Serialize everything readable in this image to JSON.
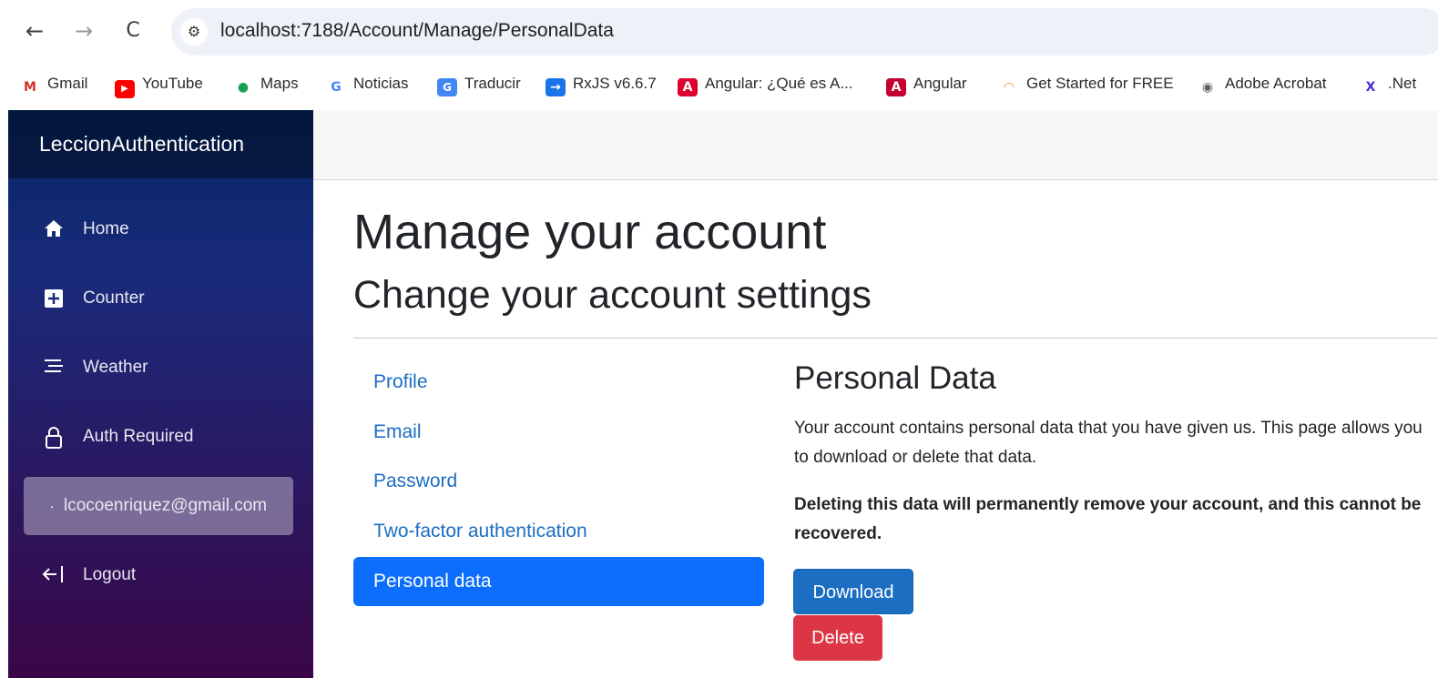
{
  "browser": {
    "back": "←",
    "forward": "→",
    "reload": "C",
    "url": "localhost:7188/Account/Manage/PersonalData"
  },
  "bookmarks": [
    {
      "label": "Gmail",
      "icon": "gmail-icon",
      "glyph": "M",
      "color": "#d93025"
    },
    {
      "label": "YouTube",
      "icon": "youtube-icon",
      "glyph": "▶",
      "color": "#ff0000"
    },
    {
      "label": "Maps",
      "icon": "maps-icon",
      "glyph": "●",
      "color": "#1a9f52"
    },
    {
      "label": "Noticias",
      "icon": "google-icon",
      "glyph": "G",
      "color": "#4285f4"
    },
    {
      "label": "Traducir",
      "icon": "translate-icon",
      "glyph": "G",
      "color": "#4285f4"
    },
    {
      "label": "RxJS v6.6.7",
      "icon": "arrow-right-icon",
      "glyph": "→",
      "color": "#1a73e8"
    },
    {
      "label": "Angular: ¿Qué es A...",
      "icon": "angular-icon",
      "glyph": "A",
      "color": "#dd0031"
    },
    {
      "label": "Angular",
      "icon": "angular-icon",
      "glyph": "A",
      "color": "#c3002f"
    },
    {
      "label": "Get Started for FREE",
      "icon": "rainbow-icon",
      "glyph": "◠",
      "color": "#f28b20"
    },
    {
      "label": "Adobe Acrobat",
      "icon": "globe-icon",
      "glyph": "◉",
      "color": "#5f6368"
    },
    {
      "label": ".Net",
      "icon": "dotnet-icon",
      "glyph": "X",
      "color": "#512bd4"
    }
  ],
  "sidebar": {
    "brand": "LeccionAuthentication",
    "items": [
      {
        "label": "Home",
        "icon": "home-icon",
        "glyph": "⌂"
      },
      {
        "label": "Counter",
        "icon": "plus-square-icon",
        "glyph": "+"
      },
      {
        "label": "Weather",
        "icon": "list-icon",
        "glyph": "≡"
      },
      {
        "label": "Auth Required",
        "icon": "lock-icon",
        "glyph": "🔒"
      },
      {
        "label": "lcocoenriquez@gmail.com",
        "icon": "user-icon",
        "glyph": "⸱"
      },
      {
        "label": "Logout",
        "icon": "logout-icon",
        "glyph": "←|"
      }
    ]
  },
  "main": {
    "title": "Manage your account",
    "subtitle": "Change your account settings",
    "nav": [
      {
        "label": "Profile"
      },
      {
        "label": "Email"
      },
      {
        "label": "Password"
      },
      {
        "label": "Two-factor authentication"
      },
      {
        "label": "Personal data"
      }
    ],
    "content": {
      "title": "Personal Data",
      "paragraph": "Your account contains personal data that you have given us. This page allows you to download or delete that data.",
      "warning": "Deleting this data will permanently remove your account, and this cannot be recovered.",
      "download_label": "Download",
      "delete_label": "Delete"
    }
  },
  "colors": {
    "primary": "#1b6ec2",
    "active_nav": "#0d6efd",
    "danger": "#dc3545",
    "sidebar_top": "#052767",
    "sidebar_bottom": "#3a0647"
  }
}
